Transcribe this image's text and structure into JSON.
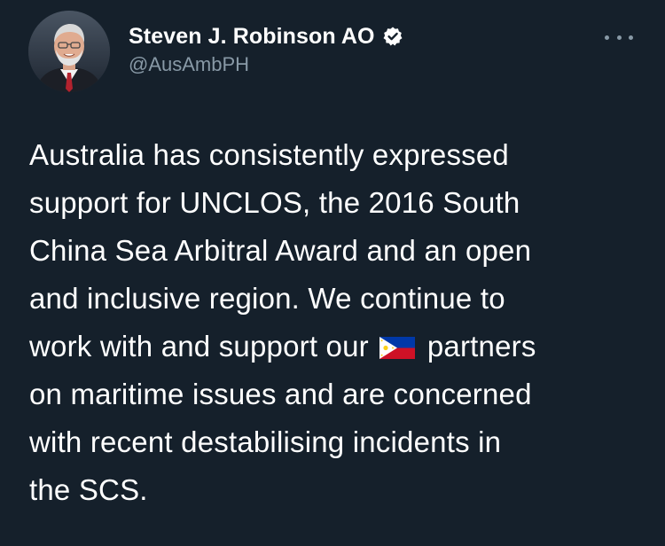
{
  "author": {
    "display_name": "Steven J. Robinson AO",
    "handle": "@AusAmbPH",
    "verified": true,
    "verified_icon": "verified-badge-icon",
    "avatar_icon": "profile-photo"
  },
  "menu": {
    "more_icon": "more-options-icon"
  },
  "tweet": {
    "lines": [
      "Australia has consistently expressed",
      "support for UNCLOS, the 2016 South",
      "China Sea Arbitral Award and an open",
      "and inclusive region. We continue to",
      "work with and support our",
      "partners",
      "on maritime issues and are concerned",
      "with recent destabilising incidents in",
      "the SCS."
    ],
    "flag_emoji": "philippines-flag-icon"
  },
  "colors": {
    "background": "#15202b",
    "text_primary": "#ffffff",
    "text_secondary": "#8899a6"
  }
}
